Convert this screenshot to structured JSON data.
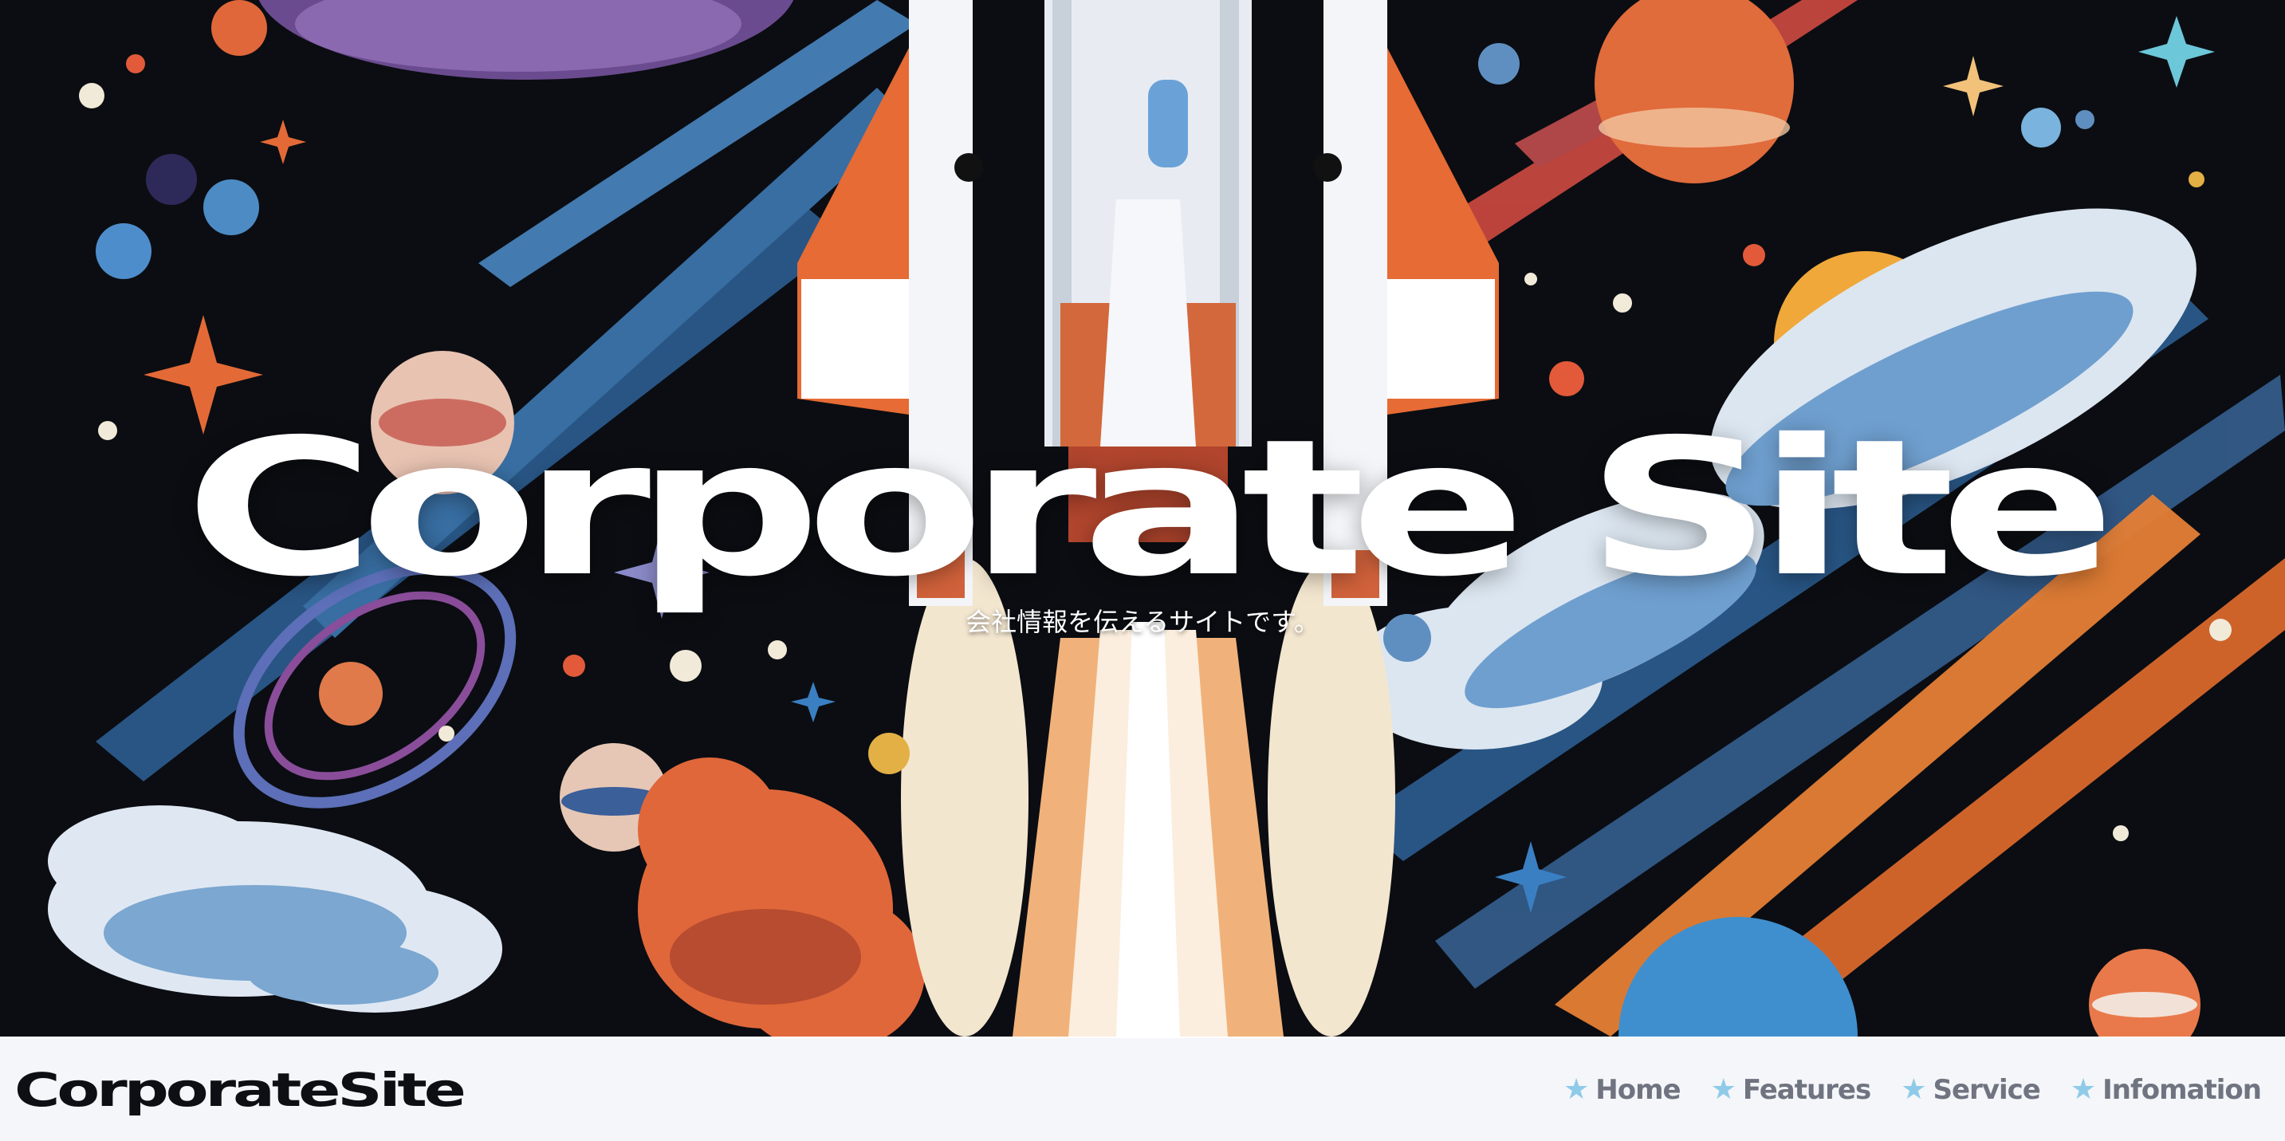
{
  "hero": {
    "title": "Corporate Site",
    "subtitle": "会社情報を伝えるサイトです。",
    "image": "space-rocket-illustration"
  },
  "header": {
    "logo": "CorporateSite",
    "nav": [
      {
        "label": "Home",
        "icon": "star-icon"
      },
      {
        "label": "Features",
        "icon": "star-icon"
      },
      {
        "label": "Service",
        "icon": "star-icon"
      },
      {
        "label": "Infomation",
        "icon": "star-icon"
      }
    ]
  },
  "colors": {
    "hero_bg": "#0b0d12",
    "header_bg": "#f4f6f9",
    "nav_text": "#6f7480",
    "star": "#8fcbe8",
    "accent_orange": "#e9713d",
    "accent_blue": "#4f86b8"
  }
}
